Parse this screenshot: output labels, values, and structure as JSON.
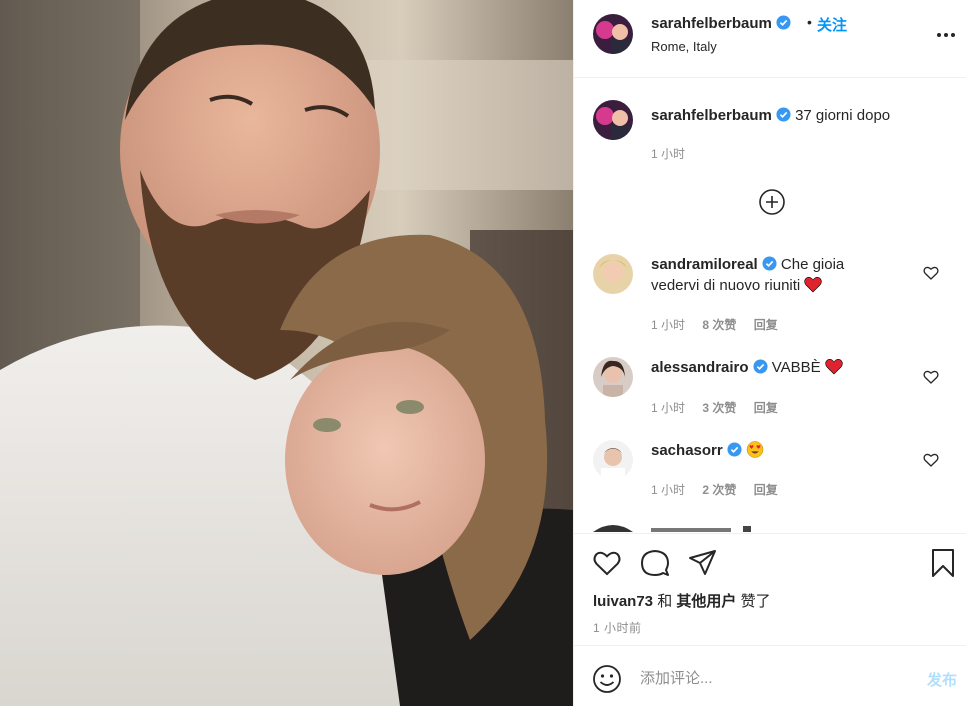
{
  "post": {
    "author": "sarahfelberbaum",
    "follow_dot": "•",
    "follow_label": "关注",
    "location": "Rome, Italy",
    "caption_text": "37 giorni dopo",
    "caption_time": "1 小时"
  },
  "comments": [
    {
      "user": "sandramiloreal",
      "text": "Che gioia vedervi di nuovo riuniti",
      "emoji": "heart-emoji",
      "time": "1 小时",
      "likes": "8 次赞",
      "reply": "回复"
    },
    {
      "user": "alessandrairo",
      "text": "VABBÈ",
      "emoji": "heart-emoji",
      "time": "1 小时",
      "likes": "3 次赞",
      "reply": "回复"
    },
    {
      "user": "sachasorr",
      "text": "",
      "emoji": "heart-eyes-emoji",
      "time": "1 小时",
      "likes": "2 次赞",
      "reply": "回复"
    }
  ],
  "likes_bar": {
    "user": "luivan73",
    "joiner": "和",
    "others": "其他用户",
    "suffix": "赞了"
  },
  "post_time": "1 小时前",
  "composer": {
    "placeholder": "添加评论...",
    "publish_label": "发布"
  },
  "colors": {
    "accent": "#0095f6",
    "publish_disabled": "#b2dffc",
    "verified": "#3897f0",
    "heart": "#ed4956"
  }
}
